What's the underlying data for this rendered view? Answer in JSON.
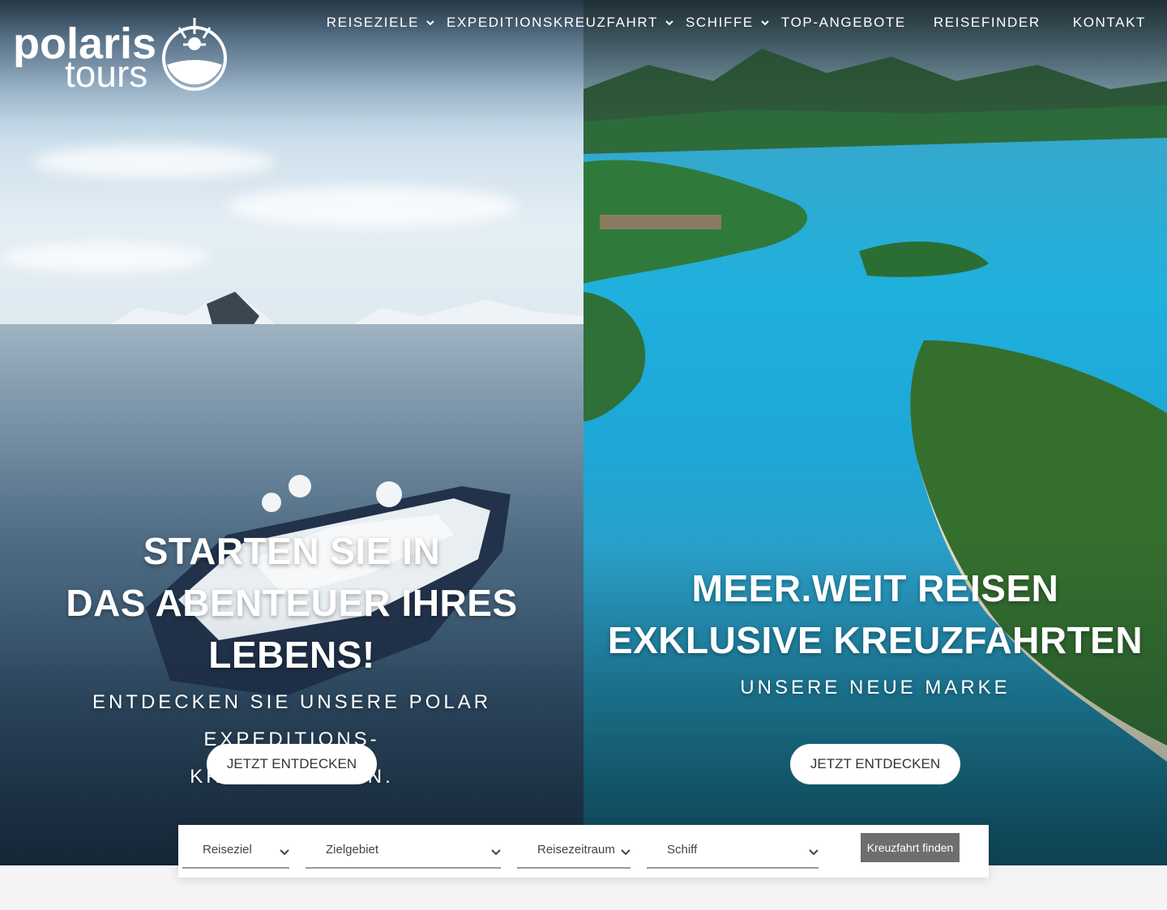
{
  "brand": {
    "line1": "polaris",
    "line2": "tours"
  },
  "nav": {
    "items": [
      {
        "label": "REISEZIELE",
        "dropdown": true
      },
      {
        "label": "EXPEDITIONSKREUZFAHRT",
        "dropdown": true
      },
      {
        "label": "SCHIFFE",
        "dropdown": true
      },
      {
        "label": "TOP-ANGEBOTE",
        "dropdown": false
      },
      {
        "label": "REISEFINDER",
        "dropdown": false
      },
      {
        "label": "KONTAKT",
        "dropdown": false
      }
    ]
  },
  "hero_left": {
    "title_line1": "STARTEN SIE IN",
    "title_line2": "DAS ABENTEUER IHRES LEBENS!",
    "subtitle_line1": "ENTDECKEN SIE UNSERE POLAR EXPEDITIONS-",
    "subtitle_line2": "KREUZFAHRTEN.",
    "button": "JETZT ENTDECKEN"
  },
  "hero_right": {
    "title_line1": "MEER.WEIT REISEN",
    "title_line2": "EXKLUSIVE KREUZFAHRTEN",
    "subtitle": "UNSERE NEUE MARKE",
    "button": "JETZT ENTDECKEN"
  },
  "search": {
    "destination": "Reiseziel",
    "area": "Zielgebiet",
    "period": "Reisezeitraum",
    "ship": "Schiff",
    "submit": "Kreuzfahrt finden"
  },
  "colors": {
    "accent": "#ffffff",
    "button_grey": "#6e6e6e",
    "page_bg": "#f4f4f4"
  }
}
